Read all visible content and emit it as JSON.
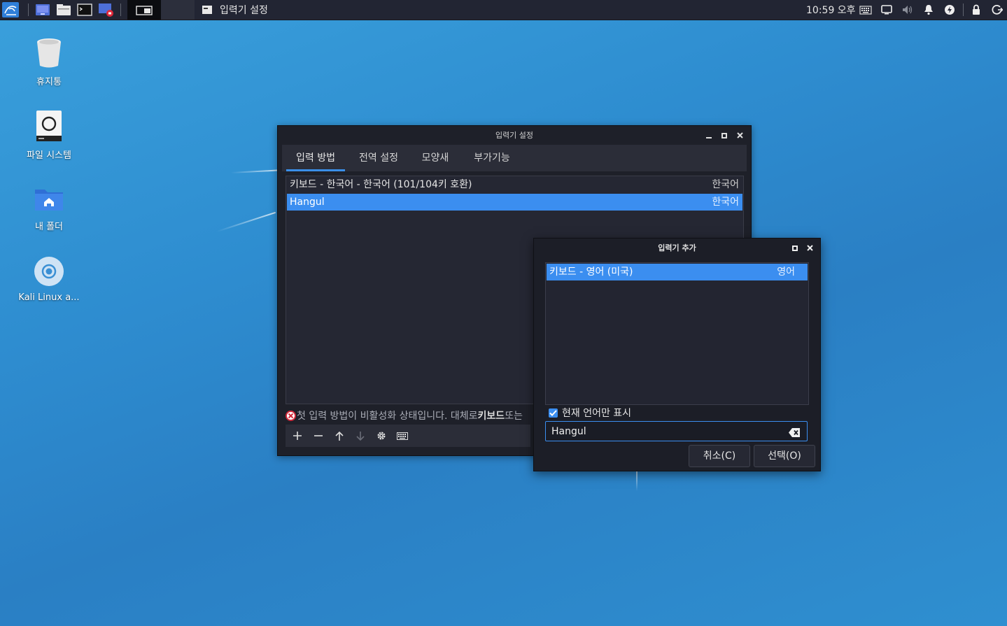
{
  "panel": {
    "active_window_title": "입력기 설정",
    "clock": "10:59 오후",
    "launchers": [
      "kali-menu-icon",
      "desktop-icon",
      "file-manager-icon",
      "terminal-icon",
      "screen-recorder-icon"
    ],
    "tray_icons": [
      "keyboard-icon",
      "display-icon",
      "volume-icon",
      "notification-icon",
      "power-icon",
      "lock-icon",
      "logout-icon"
    ]
  },
  "desktop": {
    "icons": [
      {
        "label": "휴지통",
        "icon": "trash-icon"
      },
      {
        "label": "파일 시스템",
        "icon": "drive-icon"
      },
      {
        "label": "내 폴더",
        "icon": "home-folder-icon"
      },
      {
        "label": "Kali Linux a...",
        "icon": "disc-icon"
      }
    ]
  },
  "main_window": {
    "title": "입력기 설정",
    "tabs": [
      "입력 방법",
      "전역 설정",
      "모양새",
      "부가기능"
    ],
    "active_tab": 0,
    "list": [
      {
        "name": "키보드 - 한국어 - 한국어 (101/104키 호환)",
        "lang": "한국어",
        "selected": false
      },
      {
        "name": "Hangul",
        "lang": "한국어",
        "selected": true
      }
    ],
    "warning_prefix": "첫 입력 방법이 비활성화 상태입니다. 대체로 ",
    "warning_bold": "키보드",
    "warning_suffix": " 또는",
    "toolbar_icons": [
      "add-icon",
      "remove-icon",
      "move-up-icon",
      "move-down-icon",
      "configure-icon",
      "keyboard-layout-icon"
    ]
  },
  "add_dialog": {
    "title": "입력기 추가",
    "list": [
      {
        "name": "키보드 - 영어 (미국)",
        "lang": "영어",
        "selected": true
      }
    ],
    "show_current_language_only": "현재 언어만 표시",
    "checked": true,
    "search_value": "Hangul",
    "cancel_label": "취소(C)",
    "select_label": "선택(O)"
  },
  "colors": {
    "accent": "#3b8ef0",
    "panel_bg": "#222533",
    "window_bg": "#1e2029"
  }
}
